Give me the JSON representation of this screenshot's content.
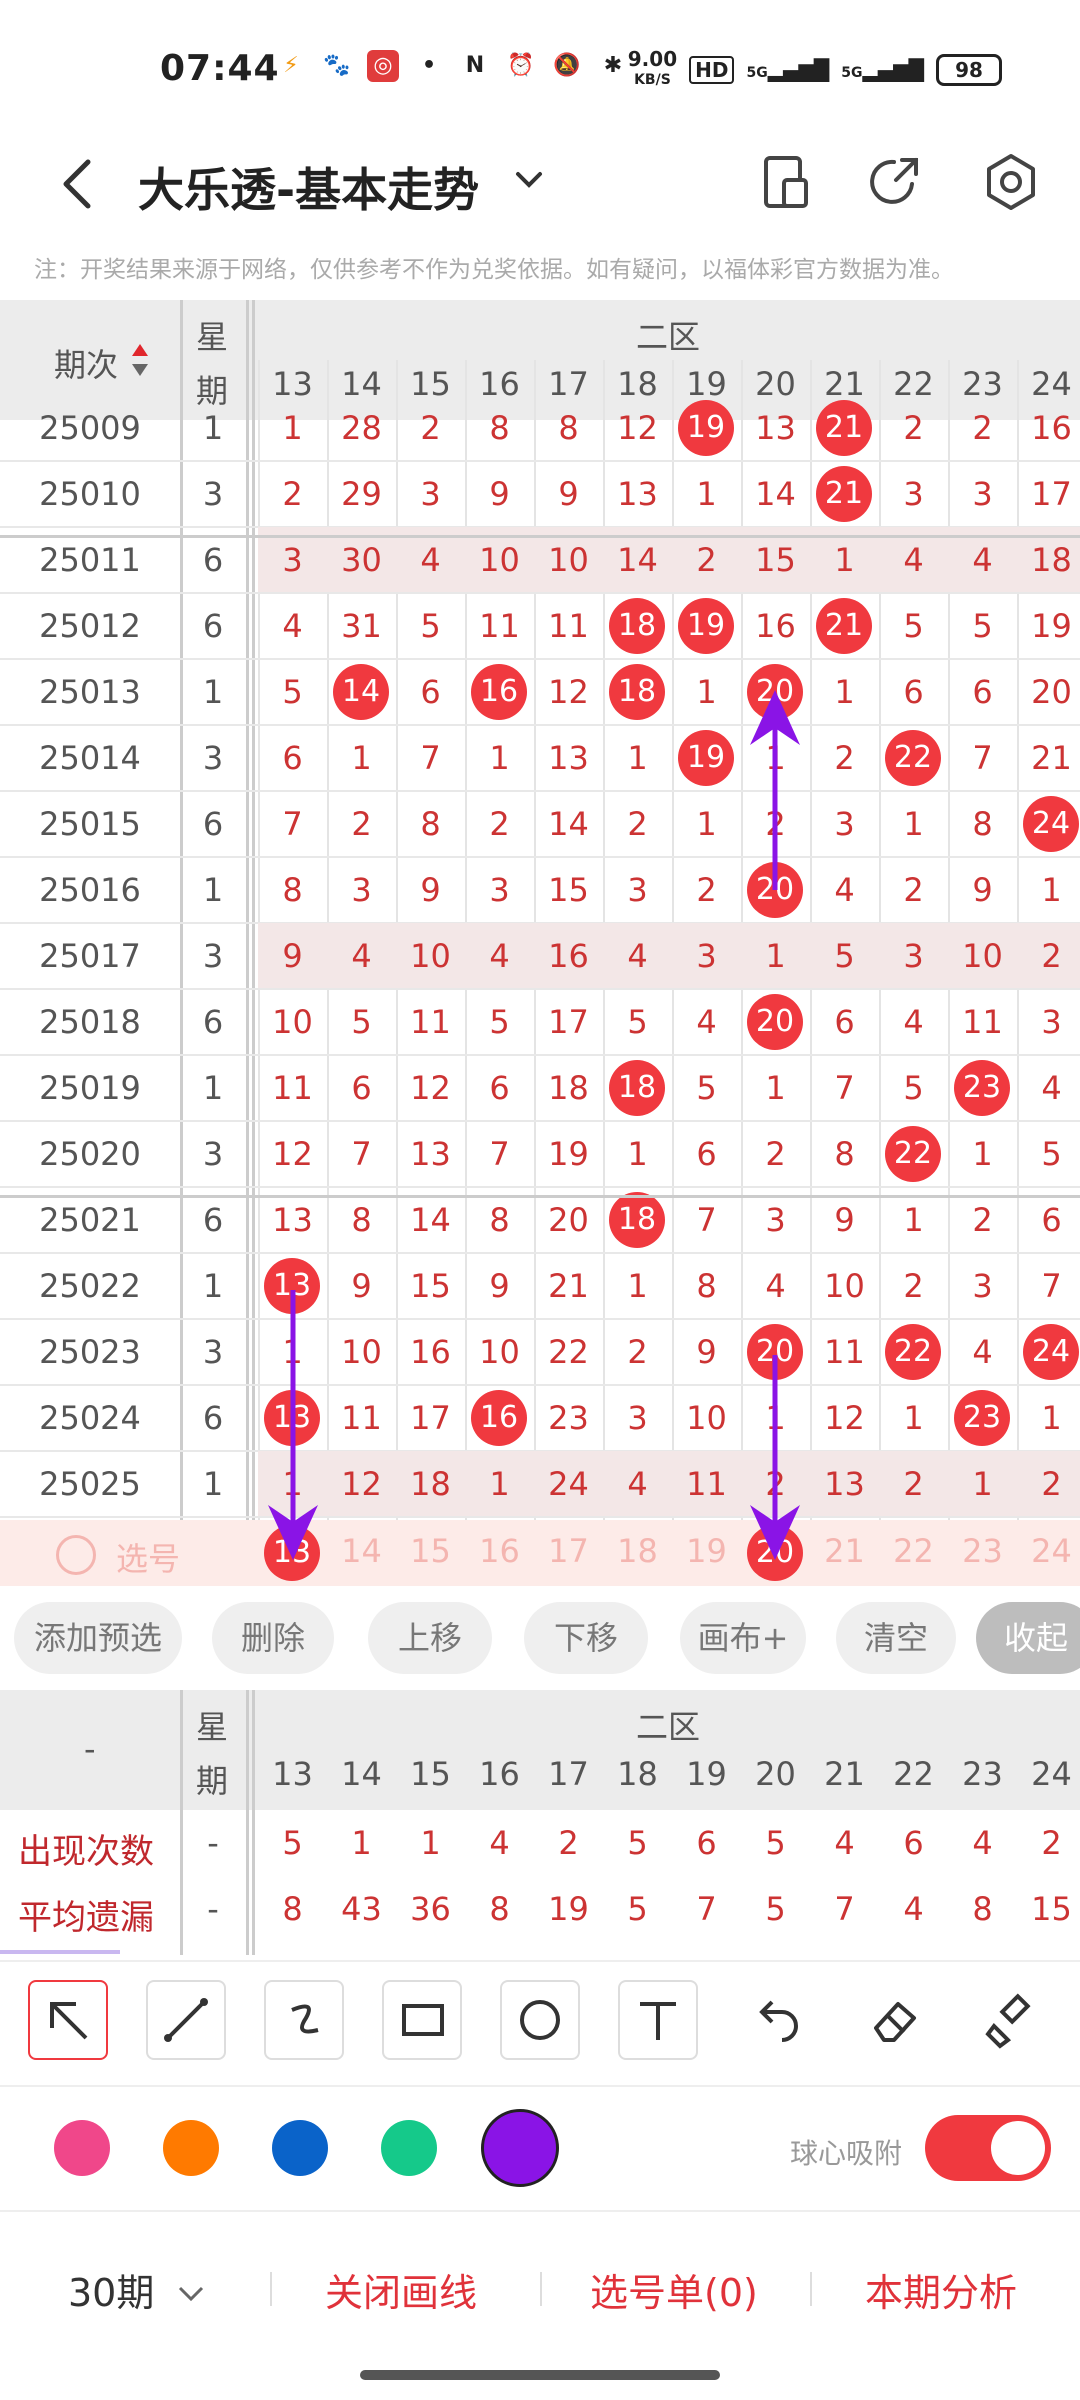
{
  "status_bar": {
    "time": "07:44",
    "net_speed_value": "9.00",
    "net_speed_unit": "KB/S",
    "hd": "HD",
    "signal1": "5G",
    "signal2": "5G",
    "battery": "98"
  },
  "header": {
    "title": "大乐透-基本走势"
  },
  "notice": "注：开奖结果来源于网络，仅供参考不作为兑奖依据。如有疑问，以福体彩官方数据为准。",
  "table": {
    "issue_header": "期次",
    "week_header_1": "星",
    "week_header_2": "期",
    "zone_label": "二区",
    "columns": [
      "13",
      "14",
      "15",
      "16",
      "17",
      "18",
      "19",
      "20",
      "21",
      "22",
      "23",
      "24"
    ],
    "rows": [
      {
        "issue": "25009",
        "week": "1",
        "cells": [
          "1",
          "28",
          "2",
          "8",
          "8",
          "12",
          "19",
          "13",
          "21",
          "2",
          "2",
          "16"
        ],
        "hits": [
          6,
          8
        ]
      },
      {
        "issue": "25010",
        "week": "3",
        "cells": [
          "2",
          "29",
          "3",
          "9",
          "9",
          "13",
          "1",
          "14",
          "21",
          "3",
          "3",
          "17"
        ],
        "hits": [
          8
        ]
      },
      {
        "issue": "25011",
        "week": "6",
        "cells": [
          "3",
          "30",
          "4",
          "10",
          "10",
          "14",
          "2",
          "15",
          "1",
          "4",
          "4",
          "18"
        ],
        "hits": []
      },
      {
        "issue": "25012",
        "week": "6",
        "cells": [
          "4",
          "31",
          "5",
          "11",
          "11",
          "18",
          "19",
          "16",
          "21",
          "5",
          "5",
          "19"
        ],
        "hits": [
          5,
          6,
          8
        ]
      },
      {
        "issue": "25013",
        "week": "1",
        "cells": [
          "5",
          "14",
          "6",
          "16",
          "12",
          "18",
          "1",
          "20",
          "1",
          "6",
          "6",
          "20"
        ],
        "hits": [
          1,
          3,
          5,
          7
        ]
      },
      {
        "issue": "25014",
        "week": "3",
        "cells": [
          "6",
          "1",
          "7",
          "1",
          "13",
          "1",
          "19",
          "1",
          "2",
          "22",
          "7",
          "21"
        ],
        "hits": [
          6,
          9
        ]
      },
      {
        "issue": "25015",
        "week": "6",
        "cells": [
          "7",
          "2",
          "8",
          "2",
          "14",
          "2",
          "1",
          "2",
          "3",
          "1",
          "8",
          "24"
        ],
        "hits": [
          11
        ]
      },
      {
        "issue": "25016",
        "week": "1",
        "cells": [
          "8",
          "3",
          "9",
          "3",
          "15",
          "3",
          "2",
          "20",
          "4",
          "2",
          "9",
          "1"
        ],
        "hits": [
          7
        ]
      },
      {
        "issue": "25017",
        "week": "3",
        "cells": [
          "9",
          "4",
          "10",
          "4",
          "16",
          "4",
          "3",
          "1",
          "5",
          "3",
          "10",
          "2"
        ],
        "hits": []
      },
      {
        "issue": "25018",
        "week": "6",
        "cells": [
          "10",
          "5",
          "11",
          "5",
          "17",
          "5",
          "4",
          "20",
          "6",
          "4",
          "11",
          "3"
        ],
        "hits": [
          7
        ]
      },
      {
        "issue": "25019",
        "week": "1",
        "cells": [
          "11",
          "6",
          "12",
          "6",
          "18",
          "18",
          "5",
          "1",
          "7",
          "5",
          "23",
          "4"
        ],
        "hits": [
          5,
          10
        ]
      },
      {
        "issue": "25020",
        "week": "3",
        "cells": [
          "12",
          "7",
          "13",
          "7",
          "19",
          "1",
          "6",
          "2",
          "8",
          "22",
          "1",
          "5"
        ],
        "hits": [
          9
        ]
      },
      {
        "issue": "25021",
        "week": "6",
        "cells": [
          "13",
          "8",
          "14",
          "8",
          "20",
          "18",
          "7",
          "3",
          "9",
          "1",
          "2",
          "6"
        ],
        "hits": [
          5
        ]
      },
      {
        "issue": "25022",
        "week": "1",
        "cells": [
          "13",
          "9",
          "15",
          "9",
          "21",
          "1",
          "8",
          "4",
          "10",
          "2",
          "3",
          "7"
        ],
        "hits": [
          0
        ]
      },
      {
        "issue": "25023",
        "week": "3",
        "cells": [
          "1",
          "10",
          "16",
          "10",
          "22",
          "2",
          "9",
          "20",
          "11",
          "22",
          "4",
          "24"
        ],
        "hits": [
          7,
          9,
          11
        ]
      },
      {
        "issue": "25024",
        "week": "6",
        "cells": [
          "13",
          "11",
          "17",
          "16",
          "23",
          "3",
          "10",
          "1",
          "12",
          "1",
          "23",
          "1"
        ],
        "hits": [
          0,
          3,
          10
        ]
      },
      {
        "issue": "25025",
        "week": "1",
        "cells": [
          "1",
          "12",
          "18",
          "1",
          "24",
          "4",
          "11",
          "2",
          "13",
          "2",
          "1",
          "2"
        ],
        "hits": []
      }
    ],
    "select_label": "选号",
    "select_balls": [
      "13",
      "20"
    ]
  },
  "actions": [
    "添加预选",
    "删除",
    "上移",
    "下移",
    "画布+",
    "清空",
    "收起"
  ],
  "stats": {
    "dash": "-",
    "week_1": "星",
    "week_2": "期",
    "zone_label": "二区",
    "rows": [
      {
        "label": "出现次数",
        "week": "-",
        "values": [
          "5",
          "1",
          "1",
          "4",
          "2",
          "5",
          "6",
          "5",
          "4",
          "6",
          "4",
          "2"
        ]
      },
      {
        "label": "平均遗漏",
        "week": "-",
        "values": [
          "8",
          "43",
          "36",
          "8",
          "19",
          "5",
          "7",
          "5",
          "7",
          "4",
          "8",
          "15"
        ]
      }
    ]
  },
  "tools": [
    "select-arrow-icon",
    "line-icon",
    "curve-icon",
    "rectangle-icon",
    "circle-icon",
    "text-icon",
    "undo-icon",
    "eraser-icon",
    "clear-brush-icon"
  ],
  "colors": [
    "#f0478a",
    "#ff7a00",
    "#0a63c9",
    "#15c98a",
    "#8a14e6"
  ],
  "snap": {
    "label": "球心吸附",
    "on": true
  },
  "bottom": {
    "periods": "30期",
    "close_draw": "关闭画线",
    "pick_list": "选号单(0)",
    "analysis": "本期分析"
  },
  "accent": "#f0393f",
  "arrow_color": "#8a14e6"
}
